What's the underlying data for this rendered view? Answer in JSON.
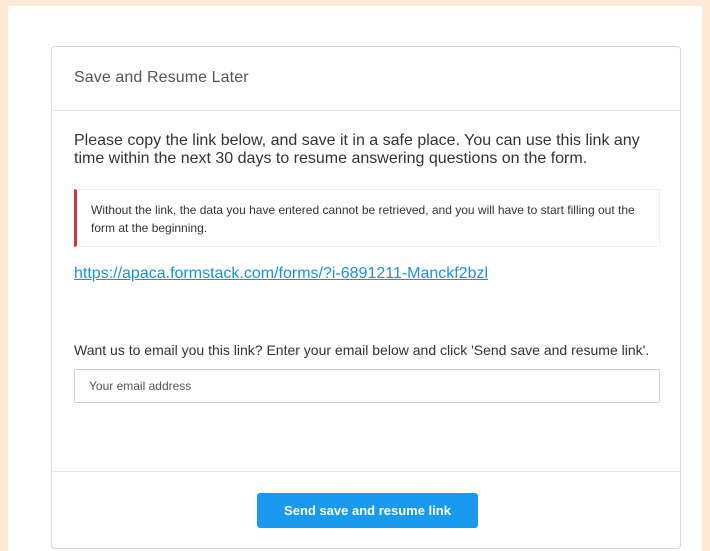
{
  "dialog": {
    "title": "Save and Resume Later",
    "intro": "Please copy the link below, and save it in a safe place. You can use this link any time within the next 30 days to resume answering questions on the form.",
    "warning": "Without the link, the data you have entered cannot be retrieved, and you will have to start filling out the form at the beginning.",
    "resume_link": "https://apaca.formstack.com/forms/?i-6891211-Manckf2bzl",
    "email_prompt": "Want us to email you this link? Enter your email below and click 'Send save and resume link'.",
    "email_placeholder": "Your email address",
    "email_value": "",
    "send_button_label": "Send save and resume link"
  },
  "colors": {
    "page_background": "#fde9d4",
    "warning_accent": "#d0363a",
    "link": "#1f8fd8",
    "button": "#1a9aef"
  }
}
